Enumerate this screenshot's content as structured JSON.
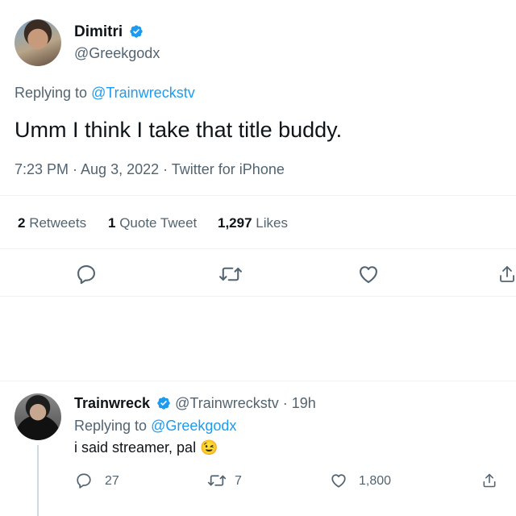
{
  "main_tweet": {
    "display_name": "Dimitri",
    "handle": "@Greekgodx",
    "replying_prefix": "Replying to",
    "replying_to": "@Trainwreckstv",
    "text": "Umm I think I take that title buddy.",
    "meta": "7:23 PM · Aug 3, 2022 · Twitter for iPhone",
    "stats": {
      "retweets_count": "2",
      "retweets_label": "Retweets",
      "quotes_count": "1",
      "quotes_label": "Quote Tweet",
      "likes_count": "1,297",
      "likes_label": "Likes"
    },
    "actions": [
      "reply-icon",
      "retweet-icon",
      "like-icon",
      "share-icon"
    ]
  },
  "reply_tweet": {
    "display_name": "Trainwreck",
    "handle_time": "@Trainwreckstv · 19h",
    "replying_prefix": "Replying to",
    "replying_to": "@Greekgodx",
    "text": "i said streamer, pal",
    "emoji": "😉",
    "reply_count": "27",
    "retweet_count": "7",
    "like_count": "1,800"
  },
  "colors": {
    "accent": "#1d9bf0",
    "muted": "#536471",
    "text": "#0f1419",
    "divider": "#eff3f4"
  }
}
